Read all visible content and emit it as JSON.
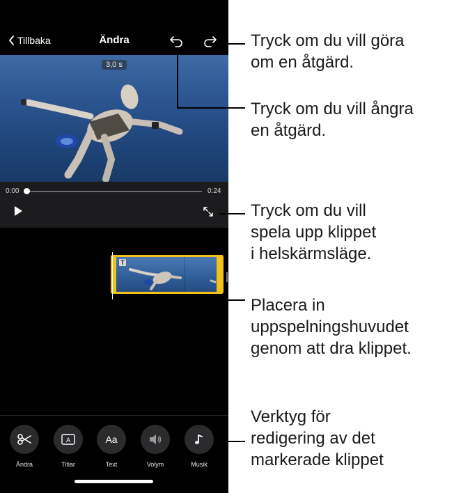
{
  "nav": {
    "back_label": "Tillbaka",
    "title": "Ändra",
    "undo_icon": "undo-arrow",
    "redo_icon": "redo-arrow"
  },
  "video": {
    "duration_badge": "3,0 s",
    "time_start": "0:00",
    "time_end": "0:24",
    "playhead_progress": 0.0
  },
  "toolbar": {
    "items": [
      {
        "icon": "scissors",
        "label": "Ändra"
      },
      {
        "icon": "titles-frame",
        "label": "Titlar"
      },
      {
        "icon": "text-aa",
        "label": "Text",
        "glyph": "Aa"
      },
      {
        "icon": "speaker",
        "label": "Volym"
      },
      {
        "icon": "music-note",
        "label": "Musik"
      }
    ]
  },
  "timeline": {
    "title_marker": "T"
  },
  "callouts": [
    "Tryck om du vill göra\nom en åtgärd.",
    "Tryck om du vill ångra\nen åtgärd.",
    "Tryck om du vill\nspela upp klippet\ni helskärmsläge.",
    "Placera in\nuppspelningshuvudet\ngenom att dra klippet.",
    "Verktyg för\nredigering av det\nmarkerade klippet"
  ],
  "colors": {
    "clip_border": "#f4c01a",
    "background": "#000000",
    "panel": "#1c1c1e"
  }
}
